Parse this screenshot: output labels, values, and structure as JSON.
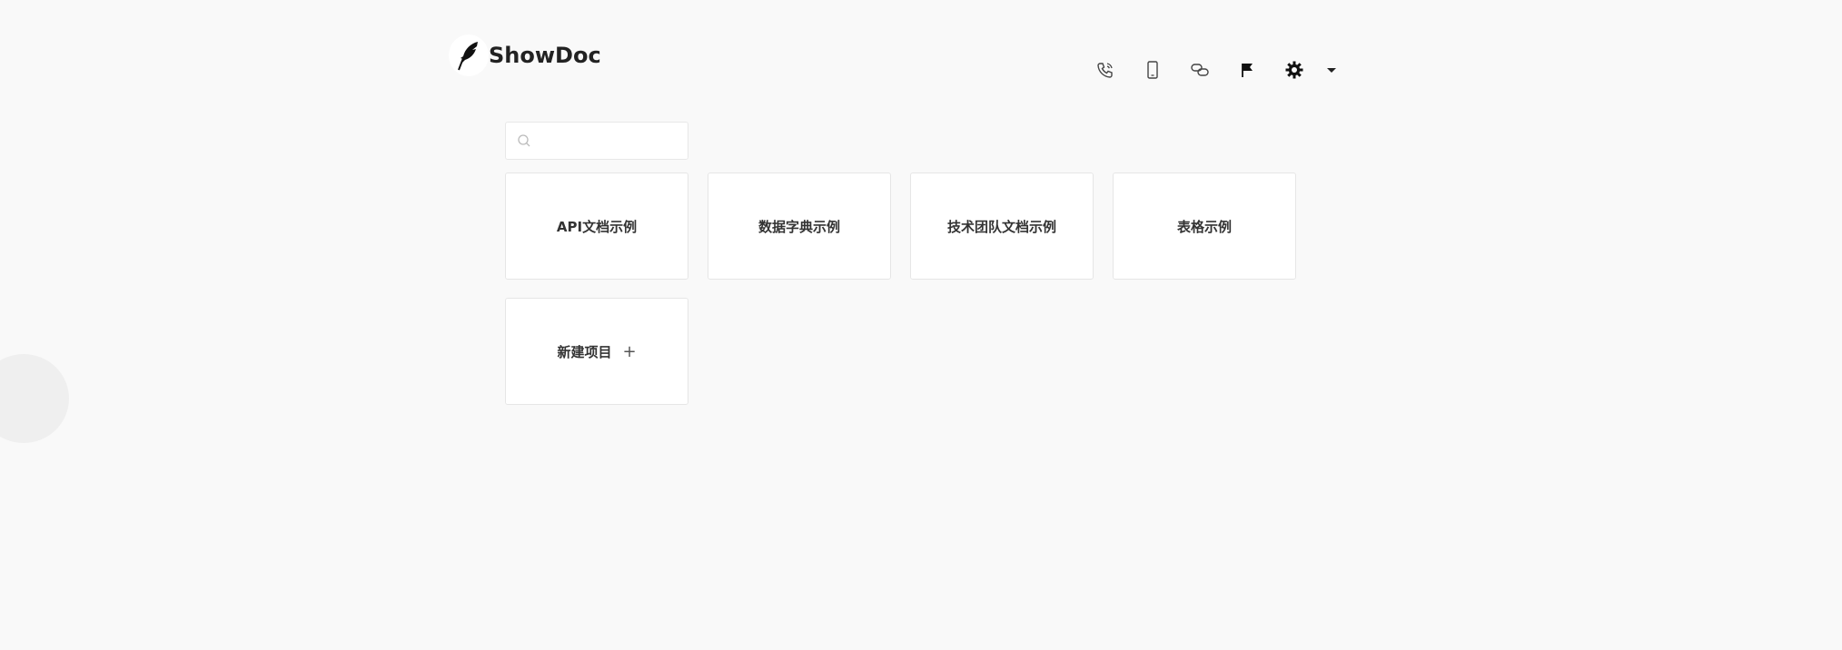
{
  "header": {
    "logo_text": "ShowDoc"
  },
  "toolbar": {
    "items": [
      {
        "icon": "phone-icon"
      },
      {
        "icon": "mobile-icon"
      },
      {
        "icon": "link-icon"
      },
      {
        "icon": "flag-icon"
      },
      {
        "icon": "gear-icon"
      },
      {
        "icon": "caret-down-icon"
      }
    ]
  },
  "search": {
    "placeholder": "",
    "value": ""
  },
  "projects": [
    {
      "label": "API文档示例"
    },
    {
      "label": "数据字典示例"
    },
    {
      "label": "技术团队文档示例"
    },
    {
      "label": "表格示例"
    }
  ],
  "new_project": {
    "label": "新建项目",
    "icon": "+"
  },
  "colors": {
    "background": "#f9f9f9",
    "card": "#ffffff",
    "border": "#e6e6e6",
    "text": "#333333"
  }
}
